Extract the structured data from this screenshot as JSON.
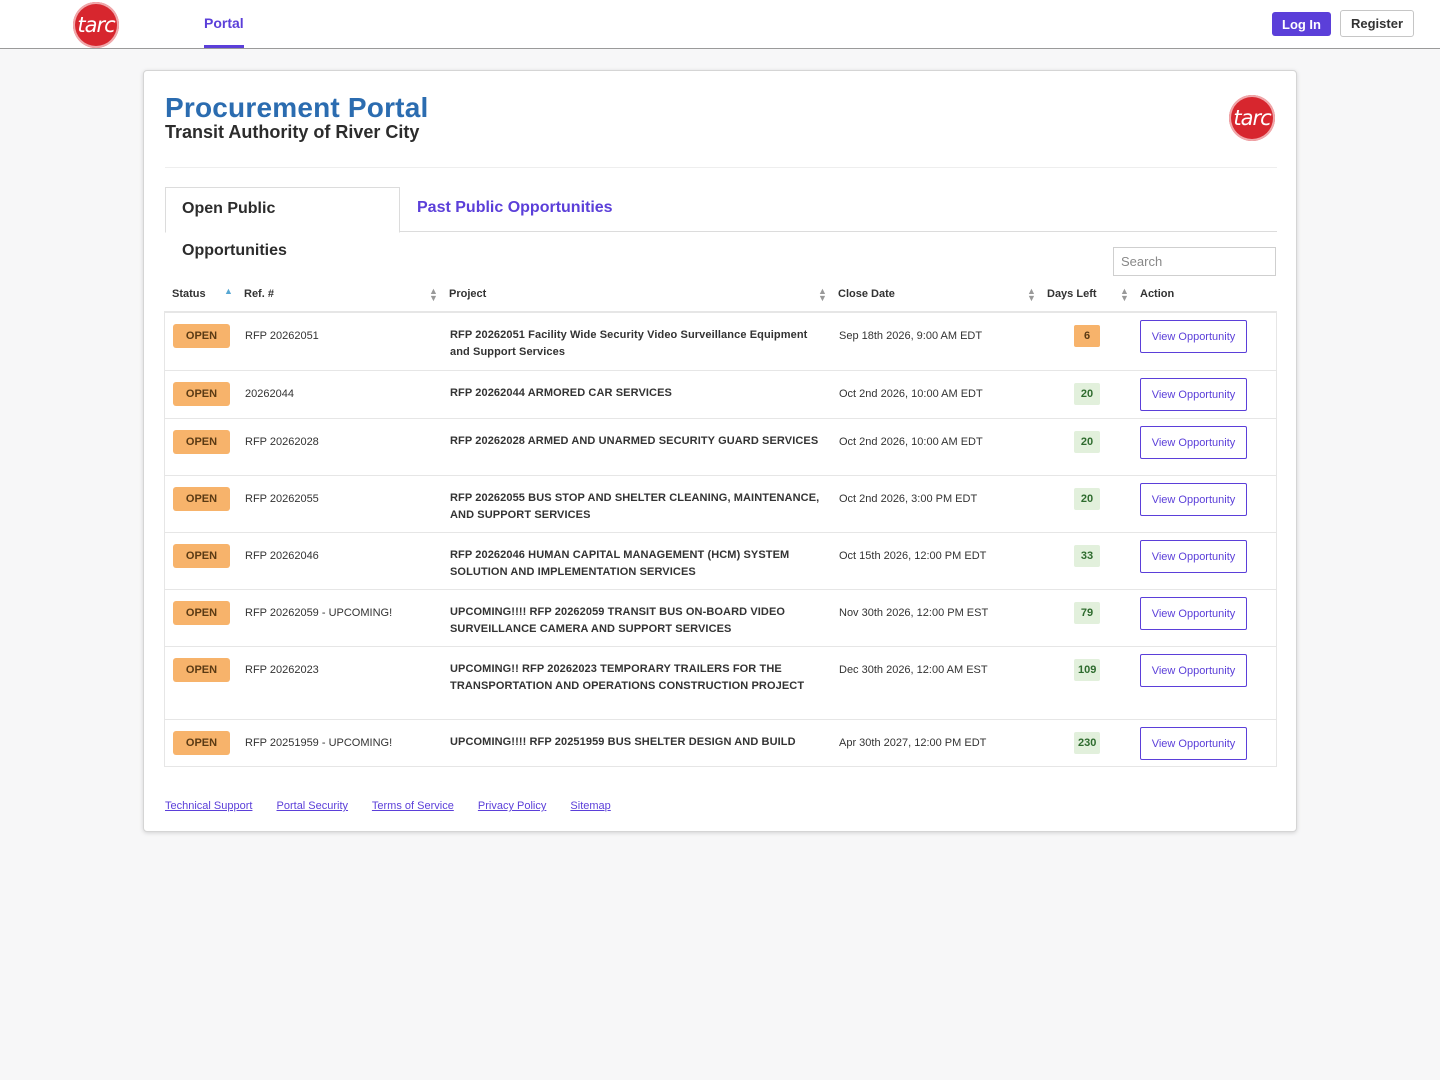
{
  "header": {
    "logo_text": "tarc",
    "nav_portal": "Portal",
    "login_label": "Log In",
    "register_label": "Register"
  },
  "page": {
    "title": "Procurement Portal",
    "subtitle": "Transit Authority of River City",
    "logo_text": "tarc"
  },
  "tabs": {
    "open": "Open Public Opportunities",
    "past": "Past Public Opportunities"
  },
  "search": {
    "placeholder": "Search"
  },
  "table": {
    "headers": {
      "status": "Status",
      "ref": "Ref. #",
      "project": "Project",
      "close_date": "Close Date",
      "days_left": "Days Left",
      "action": "Action"
    },
    "rows": [
      {
        "status": "OPEN",
        "ref": "RFP 20262051",
        "project": "RFP 20262051 Facility Wide Security Video Surveillance Equipment and Support Services",
        "close_date": "Sep 18th 2026, 9:00 AM EDT",
        "days_left": "6",
        "action": "View Opportunity"
      },
      {
        "status": "OPEN",
        "ref": "20262044",
        "project": "RFP 20262044 ARMORED CAR SERVICES",
        "close_date": "Oct 2nd 2026, 10:00 AM EDT",
        "days_left": "20",
        "action": "View Opportunity"
      },
      {
        "status": "OPEN",
        "ref": "RFP 20262028",
        "project": "RFP 20262028 ARMED AND UNARMED SECURITY GUARD SERVICES",
        "close_date": "Oct 2nd 2026, 10:00 AM EDT",
        "days_left": "20",
        "action": "View Opportunity"
      },
      {
        "status": "OPEN",
        "ref": "RFP 20262055",
        "project": "RFP 20262055 BUS STOP AND SHELTER CLEANING, MAINTENANCE, AND SUPPORT SERVICES",
        "close_date": "Oct 2nd 2026, 3:00 PM EDT",
        "days_left": "20",
        "action": "View Opportunity"
      },
      {
        "status": "OPEN",
        "ref": "RFP 20262046",
        "project": "RFP 20262046 HUMAN CAPITAL MANAGEMENT (HCM) SYSTEM SOLUTION AND IMPLEMENTATION SERVICES",
        "close_date": "Oct 15th 2026, 12:00 PM EDT",
        "days_left": "33",
        "action": "View Opportunity"
      },
      {
        "status": "OPEN",
        "ref": "RFP 20262059 - UPCOMING!",
        "project": "UPCOMING!!!! RFP 20262059 TRANSIT BUS ON-BOARD VIDEO SURVEILLANCE CAMERA AND SUPPORT SERVICES",
        "close_date": "Nov 30th 2026, 12:00 PM EST",
        "days_left": "79",
        "action": "View Opportunity"
      },
      {
        "status": "OPEN",
        "ref": "RFP 20262023",
        "project": "UPCOMING!! RFP 20262023 TEMPORARY TRAILERS FOR THE TRANSPORTATION AND OPERATIONS CONSTRUCTION PROJECT",
        "close_date": "Dec 30th 2026, 12:00 AM EST",
        "days_left": "109",
        "action": "View Opportunity"
      },
      {
        "status": "OPEN",
        "ref": "RFP 20251959 - UPCOMING!",
        "project": "UPCOMING!!!! RFP 20251959 BUS SHELTER DESIGN AND BUILD",
        "close_date": "Apr 30th 2027, 12:00 PM EDT",
        "days_left": "230",
        "action": "View Opportunity"
      }
    ]
  },
  "footer": {
    "links": [
      "Technical Support",
      "Portal Security",
      "Terms of Service",
      "Privacy Policy",
      "Sitemap"
    ]
  },
  "colors": {
    "accent": "#5b3fd9",
    "title_blue": "#2b6cb0",
    "status_open": "#f7b36b",
    "days_ok_bg": "#e2f0dc",
    "logo_red": "#d7262e"
  }
}
